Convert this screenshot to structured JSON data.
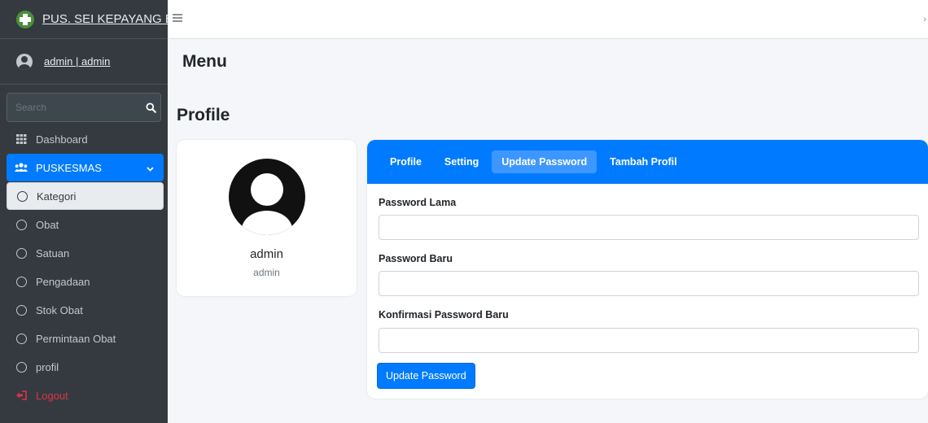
{
  "brand": {
    "title": "PUS. SEI KEPAYANG B."
  },
  "user": {
    "label": "admin | admin"
  },
  "search": {
    "placeholder": "Search"
  },
  "sidebar": {
    "items": [
      {
        "label": "Dashboard",
        "icon": "dashboard-grid-icon"
      },
      {
        "label": "PUSKESMAS",
        "icon": "users-icon"
      },
      {
        "label": "Kategori",
        "icon": "circle-icon"
      },
      {
        "label": "Obat",
        "icon": "circle-icon"
      },
      {
        "label": "Satuan",
        "icon": "circle-icon"
      },
      {
        "label": "Pengadaan",
        "icon": "circle-icon"
      },
      {
        "label": "Stok Obat",
        "icon": "circle-icon"
      },
      {
        "label": "Permintaan Obat",
        "icon": "circle-icon"
      },
      {
        "label": "profil",
        "icon": "circle-icon"
      },
      {
        "label": "Logout",
        "icon": "logout-icon"
      }
    ]
  },
  "main": {
    "title": "Menu",
    "heading": "Profile",
    "profile_card": {
      "name": "admin",
      "role": "admin"
    },
    "tabs": [
      {
        "label": "Profile"
      },
      {
        "label": "Setting"
      },
      {
        "label": "Update Password"
      },
      {
        "label": "Tambah Profil"
      }
    ],
    "form": {
      "old_password_label": "Password Lama",
      "new_password_label": "Password Baru",
      "confirm_password_label": "Konfirmasi Password Baru",
      "submit_label": "Update Password"
    }
  },
  "colors": {
    "sidebar_bg": "#343a40",
    "accent": "#007bff",
    "logout": "#dc3545",
    "content_bg": "#f4f6f9"
  }
}
